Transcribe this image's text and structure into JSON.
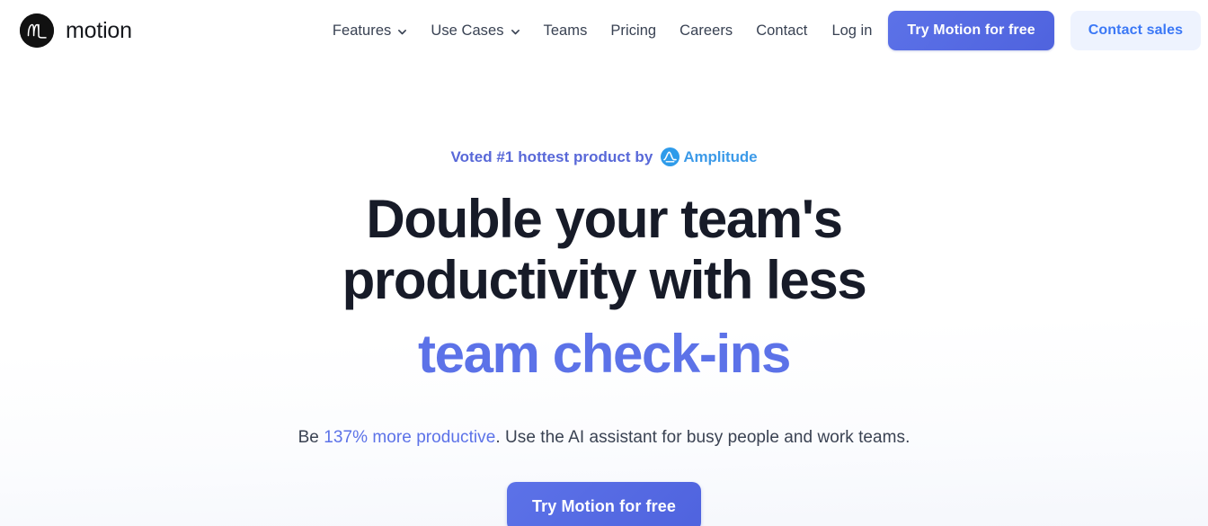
{
  "header": {
    "brand": {
      "name": "motion",
      "logo_icon": "motion-m-logo-icon"
    },
    "nav": [
      {
        "label": "Features",
        "has_dropdown": true,
        "icon": "chevron-down-icon"
      },
      {
        "label": "Use Cases",
        "has_dropdown": true,
        "icon": "chevron-down-icon"
      },
      {
        "label": "Teams",
        "has_dropdown": false,
        "icon": ""
      },
      {
        "label": "Pricing",
        "has_dropdown": false,
        "icon": ""
      },
      {
        "label": "Careers",
        "has_dropdown": false,
        "icon": ""
      },
      {
        "label": "Contact",
        "has_dropdown": false,
        "icon": ""
      }
    ],
    "login_label": "Log in",
    "try_free_label": "Try Motion for free",
    "contact_sales_label": "Contact sales"
  },
  "hero": {
    "eyebrow_text": "Voted #1 hottest product by",
    "amplitude": {
      "icon": "amplitude-logo-icon",
      "name": "Amplitude"
    },
    "title_line1": "Double your team's",
    "title_line2": "productivity with less",
    "title_accent": "team check-ins",
    "sub_before": "Be ",
    "sub_link": "137% more productive",
    "sub_after": ". Use the AI assistant for busy people and work teams.",
    "cta_label": "Try Motion for free"
  },
  "colors": {
    "accent_blue": "#5c72e8",
    "link_blue": "#3b78f6",
    "amplitude_blue": "#3c9ae8",
    "heading_dark": "#171b28",
    "nav_text": "#394253",
    "soft_button_bg": "#eef3fe",
    "page_bg": "#ffffff"
  }
}
